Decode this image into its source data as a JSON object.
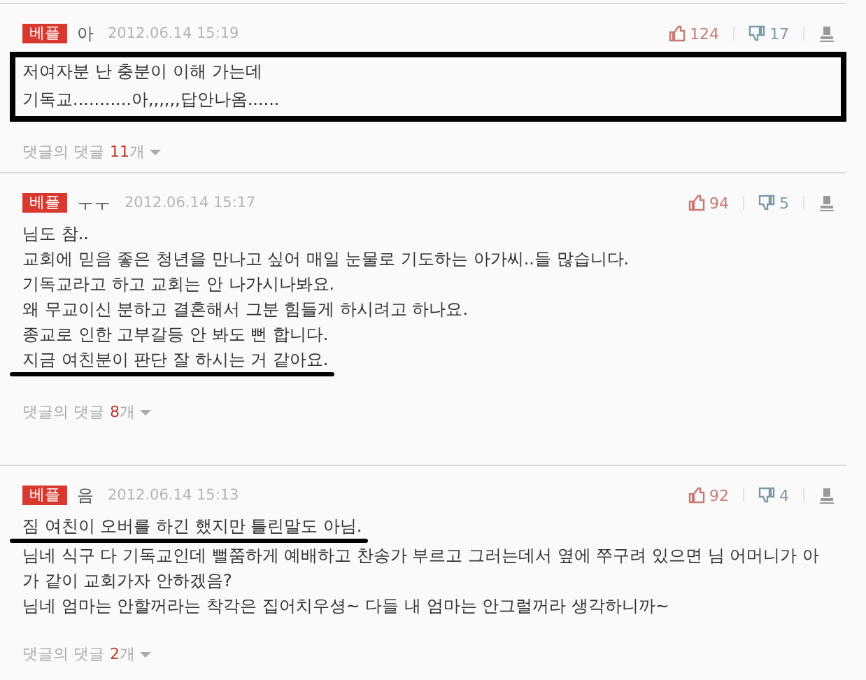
{
  "comments": [
    {
      "badge": "베플",
      "author": "아",
      "date": "2012.06.14 15:19",
      "likes": "124",
      "dislikes": "17",
      "boxed": true,
      "lines": [
        {
          "text": "저여자분 난 충분이 이해 가는데",
          "underlined": false
        },
        {
          "text": "기독교...........아,,,,,,답안나옴......",
          "underlined": false
        }
      ],
      "replies": {
        "label": "댓글의 댓글",
        "count": "11",
        "unit": "개"
      }
    },
    {
      "badge": "베플",
      "author": "ㅜㅜ",
      "date": "2012.06.14 15:17",
      "likes": "94",
      "dislikes": "5",
      "boxed": false,
      "lines": [
        {
          "text": "님도 참..",
          "underlined": false
        },
        {
          "text": "교회에 믿음 좋은 청년을 만나고 싶어 매일 눈물로 기도하는 아가씨..들 많습니다.",
          "underlined": false
        },
        {
          "text": "기독교라고 하고 교회는 안 나가시나봐요.",
          "underlined": false
        },
        {
          "text": "왜 무교이신 분하고 결혼해서 그분 힘들게 하시려고 하나요.",
          "underlined": false
        },
        {
          "text": "종교로 인한 고부갈등 안 봐도 뻔 합니다.",
          "underlined": false
        },
        {
          "text": "지금 여친분이 판단 잘 하시는 거 같아요.",
          "underlined": true
        }
      ],
      "replies": {
        "label": "댓글의 댓글",
        "count": "8",
        "unit": "개"
      }
    },
    {
      "badge": "베플",
      "author": "음",
      "date": "2012.06.14 15:13",
      "likes": "92",
      "dislikes": "4",
      "boxed": false,
      "lines": [
        {
          "text": "짐 여친이 오버를 하긴 했지만 틀린말도 아님.",
          "underlined": true
        },
        {
          "text": "님네 식구 다 기독교인데 뻘쭘하게 예배하고 찬송가 부르고 그러는데서 옆에 쭈구려 있으면 님 어머니가 아",
          "underlined": false
        },
        {
          "text": "가 같이 교회가자 안하겠음?",
          "underlined": false
        },
        {
          "text": "님네 엄마는 안할꺼라는 착각은 집어치우셩~ 다들 내 엄마는 안그럴꺼라 생각하니까~",
          "underlined": false
        }
      ],
      "replies": {
        "label": "댓글의 댓글",
        "count": "2",
        "unit": "개"
      }
    }
  ]
}
